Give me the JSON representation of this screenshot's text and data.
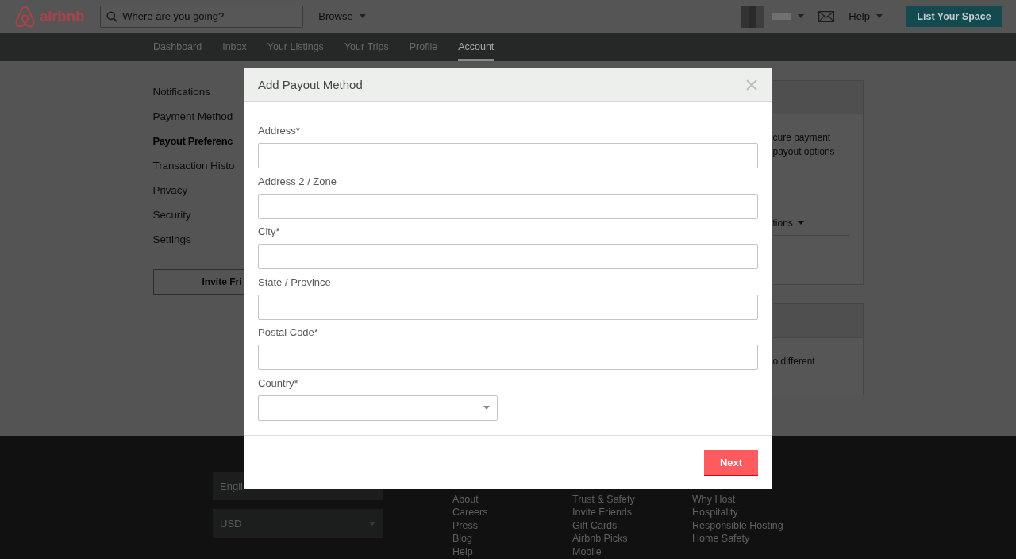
{
  "header": {
    "logo_text": "airbnb",
    "search": {
      "placeholder": "Where are you going?"
    },
    "browse": "Browse",
    "help": "Help",
    "cta": "List Your Space"
  },
  "nav": [
    {
      "label": "Dashboard",
      "selected": false
    },
    {
      "label": "Inbox",
      "selected": false
    },
    {
      "label": "Your Listings",
      "selected": false
    },
    {
      "label": "Your Trips",
      "selected": false
    },
    {
      "label": "Profile",
      "selected": false
    },
    {
      "label": "Account",
      "selected": true
    }
  ],
  "sidebar": {
    "items": [
      {
        "label": "Notifications",
        "selected": false
      },
      {
        "label": "Payment Method",
        "selected": false
      },
      {
        "label": "Payout Preferenc",
        "selected": true
      },
      {
        "label": "Transaction Histo",
        "selected": false
      },
      {
        "label": "Privacy",
        "selected": false
      },
      {
        "label": "Security",
        "selected": false
      },
      {
        "label": "Settings",
        "selected": false
      }
    ],
    "button": "Invite Fri"
  },
  "panels": [
    {
      "lines": [
        "cure payment",
        "payout options"
      ],
      "dropdown": "tions"
    },
    {
      "lines": [
        "o different"
      ]
    }
  ],
  "modal": {
    "title": "Add Payout Method",
    "fields": [
      {
        "label": "Address*",
        "kind": "text"
      },
      {
        "label": "Address 2 / Zone",
        "kind": "text"
      },
      {
        "label": "City*",
        "kind": "text"
      },
      {
        "label": "State / Province",
        "kind": "text"
      },
      {
        "label": "Postal Code*",
        "kind": "text"
      },
      {
        "label": "Country*",
        "kind": "select"
      }
    ],
    "button": "Next"
  },
  "footer": {
    "language": "Engli",
    "currency": "USD",
    "columns": [
      [
        "About",
        "Careers",
        "Press",
        "Blog",
        "Help"
      ],
      [
        "Trust & Safety",
        "Invite Friends",
        "Gift Cards",
        "Airbnb Picks",
        "Mobile"
      ],
      [
        "Why Host",
        "Hospitality",
        "Responsible Hosting",
        "Home Safety"
      ]
    ]
  }
}
